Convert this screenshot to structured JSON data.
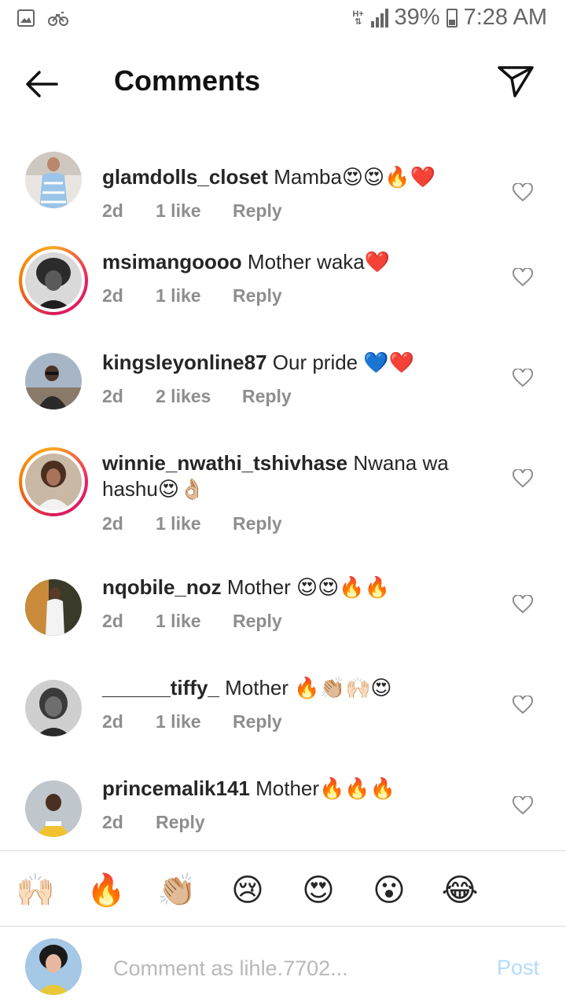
{
  "status_bar": {
    "network": "H+",
    "battery": "39%",
    "time": "7:28 AM"
  },
  "header": {
    "title": "Comments"
  },
  "comments": [
    {
      "username": "glamdolls_closet",
      "text": "Mamba😍😍🔥❤️",
      "time": "2d",
      "likes": "1 like",
      "reply": "Reply"
    },
    {
      "username": "msimangoooo",
      "text": "Mother waka❤️",
      "time": "2d",
      "likes": "1 like",
      "reply": "Reply"
    },
    {
      "username": "kingsleyonline87",
      "text": "Our pride 💙❤️",
      "time": "2d",
      "likes": "2 likes",
      "reply": "Reply"
    },
    {
      "username": "winnie_nwathi_tshivhase",
      "text": "Nwana wa hashu😍👌🏼",
      "time": "2d",
      "likes": "1 like",
      "reply": "Reply"
    },
    {
      "username": "nqobile_noz",
      "text": "Mother 😍😍🔥🔥",
      "time": "2d",
      "likes": "1 like",
      "reply": "Reply"
    },
    {
      "username": "______tiffy_",
      "text": "Mother 🔥👏🏼🙌🏻😍",
      "time": "2d",
      "likes": "1 like",
      "reply": "Reply"
    },
    {
      "username": "princemalik141",
      "text": "Mother🔥🔥🔥",
      "time": "2d",
      "likes": "",
      "reply": "Reply"
    }
  ],
  "quick_emojis": [
    "🙌🏻",
    "🔥",
    "👏🏼",
    "😢",
    "😍",
    "😮",
    "😂"
  ],
  "composer": {
    "placeholder": "Comment as lihle.7702...",
    "post_label": "Post"
  }
}
